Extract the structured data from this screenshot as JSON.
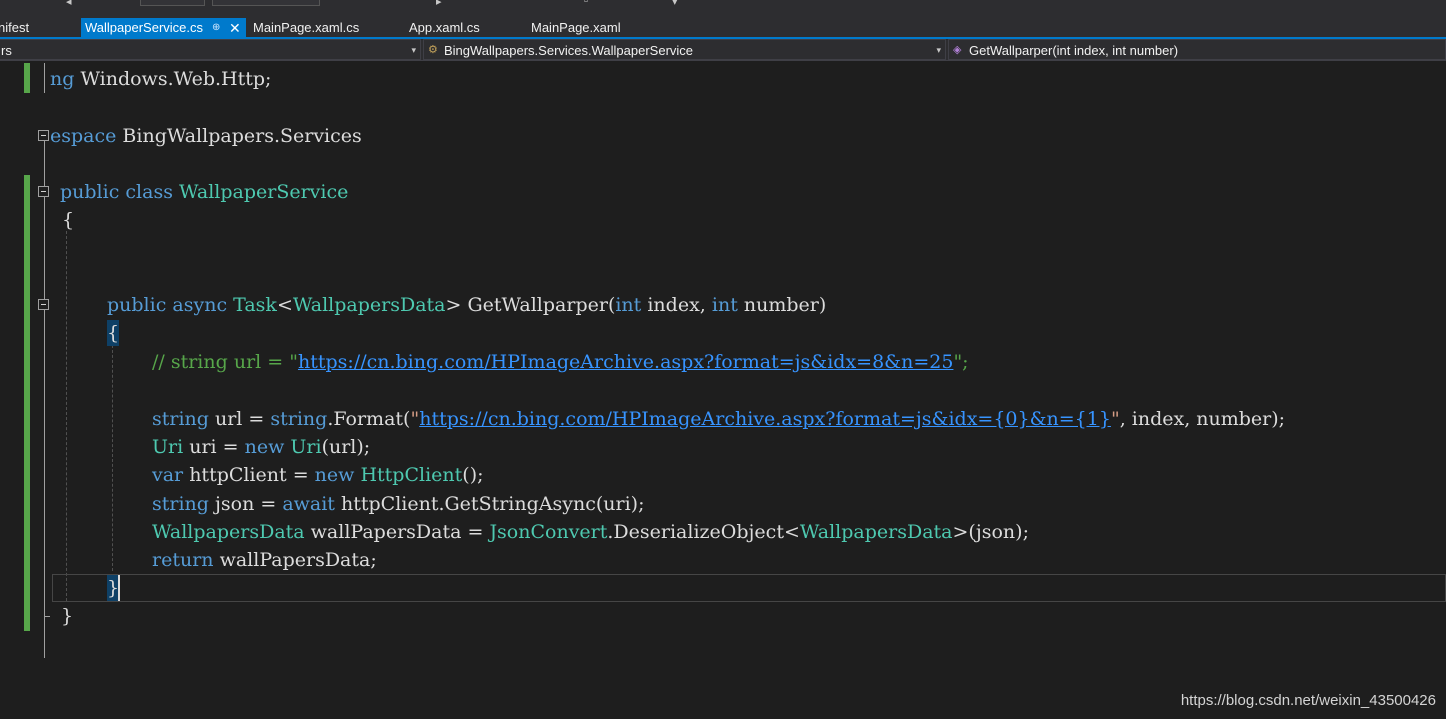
{
  "tabs": [
    {
      "label": "nifest",
      "active": false
    },
    {
      "label": "WallpaperService.cs",
      "active": true,
      "pin": "⊕",
      "close": "✕"
    },
    {
      "label": "MainPage.xaml.cs",
      "active": false
    },
    {
      "label": "App.xaml.cs",
      "active": false
    },
    {
      "label": "MainPage.xaml",
      "active": false
    }
  ],
  "navbar": {
    "project": "rs",
    "class": "BingWallpapers.Services.WallpaperService",
    "member": "GetWallparper(int index, int number)",
    "dropdown_glyph": "▾"
  },
  "code": {
    "using_kw": "ng",
    "using_rest": " Windows.Web.Http;",
    "ns_kw": "espace",
    "ns_name": " BingWallpapers.Services",
    "class_public": "public",
    "class_kw": "class",
    "class_name": "WallpaperService",
    "brace_open": "{",
    "brace_close": "}",
    "m_public": "public",
    "m_async": "async",
    "m_task": "Task",
    "m_lt": "<",
    "m_type": "WallpapersData",
    "m_gt": ">",
    "m_name": " GetWallparper(",
    "m_int1": "int",
    "m_p1": " index, ",
    "m_int2": "int",
    "m_p2": " number)",
    "comment_prefix": "// string url = \"",
    "comment_url": "https://cn.bing.com/HPImageArchive.aspx?format=js&idx=8&n=25",
    "comment_suffix": "\";",
    "l1_string": "string",
    "l1_var": " url = ",
    "l1_string2": "string",
    "l1_fmt": ".Format(",
    "l1_q1": "\"",
    "l1_url": "https://cn.bing.com/HPImageArchive.aspx?format=js&idx={0}&n={1}",
    "l1_q2": "\"",
    "l1_rest": ", index, number);",
    "l2_uri": "Uri",
    "l2_var": " uri = ",
    "l2_new": "new",
    "l2_uri2": "Uri",
    "l2_rest": "(url);",
    "l3_var": "var",
    "l3_name": " httpClient = ",
    "l3_new": "new",
    "l3_type": "HttpClient",
    "l3_rest": "();",
    "l4_string": "string",
    "l4_name": " json = ",
    "l4_await": "await",
    "l4_rest": " httpClient.GetStringAsync(uri);",
    "l5_type": "WallpapersData",
    "l5_name": " wallPapersData = ",
    "l5_json": "JsonConvert",
    "l5_call": ".DeserializeObject<",
    "l5_type2": "WallpapersData",
    "l5_rest": ">(json);",
    "l6_return": "return",
    "l6_rest": " wallPapersData;"
  },
  "watermark": "https://blog.csdn.net/weixin_43500426",
  "colors": {
    "keyword": "#569cd6",
    "type": "#4ec9b0",
    "comment": "#57a64a",
    "url": "#3794ff",
    "active_tab": "#007acc",
    "background": "#1e1e1e"
  }
}
